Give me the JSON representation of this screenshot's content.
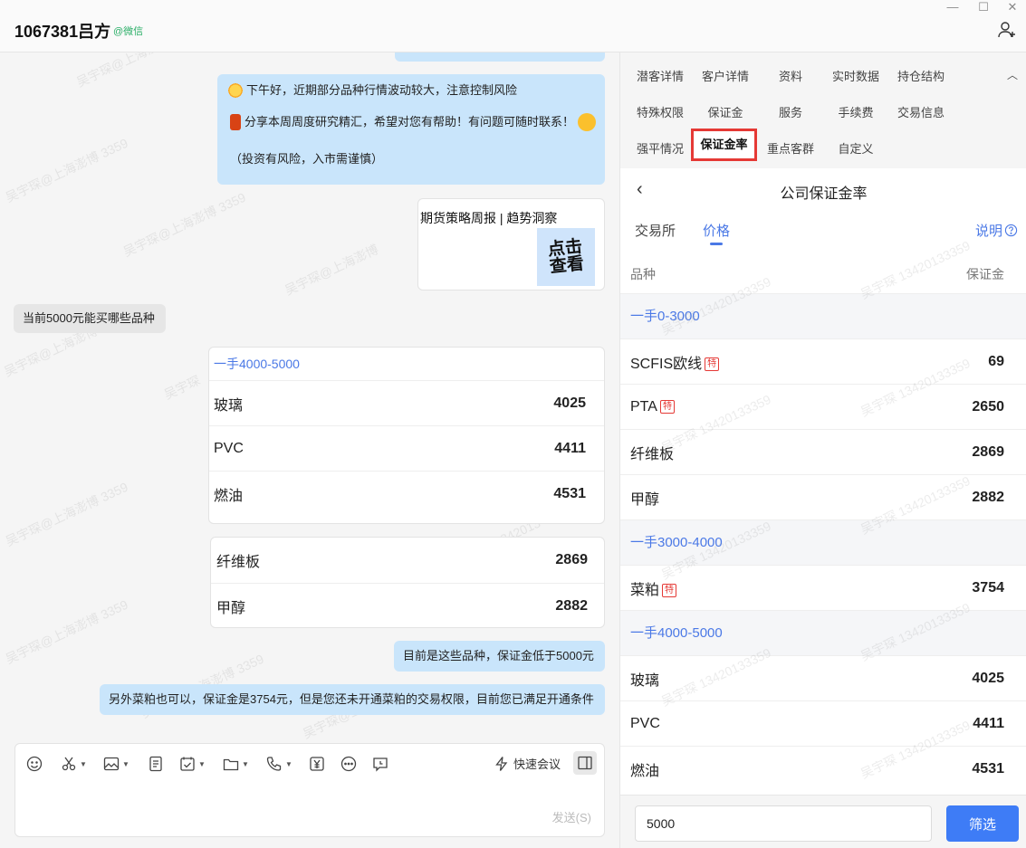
{
  "header": {
    "contact_name": "1067381吕方",
    "contact_tag": "@微信"
  },
  "chat": {
    "msg1": {
      "line1": "下午好，近期部分品种行情波动较大，注意控制风险",
      "line2": "分享本周周度研究精汇，希望对您有帮助！有问题可随时联系！",
      "line3": "（投资有风险，入市需谨慎）"
    },
    "article_card": {
      "title": "期货策略周报 | 趋势洞察",
      "thumb_text": "点击查看"
    },
    "question": "当前5000元能买哪些品种",
    "card1": {
      "group": "一手4000-5000",
      "rows": [
        {
          "name": "玻璃",
          "value": "4025"
        },
        {
          "name": "PVC",
          "value": "4411"
        },
        {
          "name": "燃油",
          "value": "4531"
        }
      ]
    },
    "card2": {
      "rows": [
        {
          "name": "纤维板",
          "value": "2869"
        },
        {
          "name": "甲醇",
          "value": "2882"
        }
      ]
    },
    "reply1": "目前是这些品种，保证金低于5000元",
    "reply2": "另外菜粕也可以，保证金是3754元，但是您还未开通菜粕的交易权限，目前您已满足开通条件"
  },
  "composer": {
    "meeting_label": "快速会议",
    "send_label": "发送(S)"
  },
  "panel": {
    "tabs": {
      "t1": "潜客详情",
      "t2": "客户详情",
      "t3": "资料",
      "t4": "实时数据",
      "t5": "持仓结构",
      "t6": "特殊权限",
      "t7": "保证金",
      "t8": "服务",
      "t9": "手续费",
      "t10": "交易信息",
      "t11": "强平情况",
      "t12": "保证金率",
      "t13": "重点客群",
      "t14": "自定义"
    },
    "title": "公司保证金率",
    "subtab_exchange": "交易所",
    "subtab_price": "价格",
    "help": "说明",
    "col_variety": "品种",
    "col_margin": "保证金",
    "badge": "特",
    "groups": [
      {
        "label": "一手0-3000",
        "rows": [
          {
            "name": "SCFIS欧线",
            "badge": true,
            "value": "69"
          },
          {
            "name": "PTA",
            "badge": true,
            "value": "2650"
          },
          {
            "name": "纤维板",
            "badge": false,
            "value": "2869"
          },
          {
            "name": "甲醇",
            "badge": false,
            "value": "2882"
          }
        ]
      },
      {
        "label": "一手3000-4000",
        "rows": [
          {
            "name": "菜粕",
            "badge": true,
            "value": "3754"
          }
        ]
      },
      {
        "label": "一手4000-5000",
        "rows": [
          {
            "name": "玻璃",
            "badge": false,
            "value": "4025"
          },
          {
            "name": "PVC",
            "badge": false,
            "value": "4411"
          },
          {
            "name": "燃油",
            "badge": false,
            "value": "4531"
          }
        ]
      }
    ],
    "filter_value": "5000",
    "filter_button": "筛选"
  }
}
